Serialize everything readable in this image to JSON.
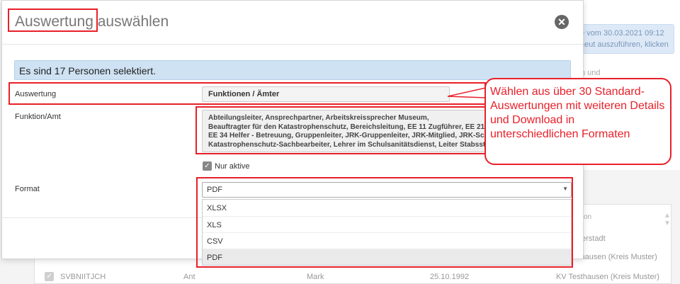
{
  "background": {
    "notice_line1": "e vom 30.03.2021 09:12",
    "notice_line2": "neut auszuführen, klicken",
    "side_text": "n und",
    "table_header": "tion",
    "sort_icon": "sort-icon",
    "row1_end": "erstadt",
    "row2_end": "sthausen (Kreis Muster)",
    "row3": {
      "col1": "SVBNIITJCH",
      "col2": "Ant",
      "col3": "Mark",
      "col4": "25.10.1992",
      "col5": "KV Testhausen (Kreis Muster)"
    }
  },
  "modal": {
    "title_part1": "Auswertung",
    "title_part2": " auswählen",
    "close_icon": "close-icon",
    "info": "Es sind 17 Personen selektiert.",
    "auswertung": {
      "label": "Auswertung",
      "value": "Funktionen / Ämter"
    },
    "funktion": {
      "label": "Funktion/Amt",
      "lines": [
        "Abteilungsleiter, Ansprechpartner, Arbeitskreissprecher Museum,",
        "Beauftragter für den Katastrophenschutz, Bereichsleitung, EE 11 Zugführer, EE 21",
        "EE 34 Helfer - Betreuung, Gruppenleiter, JRK-Gruppenleiter, JRK-Mitglied, JRK-Sch",
        "Katastrophenschutz-Sachbearbeiter, Lehrer im Schulsanitätsdienst, Leiter Stabsst"
      ]
    },
    "nur_aktive": "Nur aktive",
    "format": {
      "label": "Format",
      "selected": "PDF",
      "options": [
        "XLSX",
        "XLS",
        "CSV",
        "PDF"
      ]
    }
  },
  "callout": {
    "text": "Wählen aus über 30 Standard-Auswertungen mit weiteren Details und Download in unterschiedlichen Formaten"
  },
  "colors": {
    "annotation_red": "#e8202a",
    "info_blue": "#cfe2f3"
  }
}
